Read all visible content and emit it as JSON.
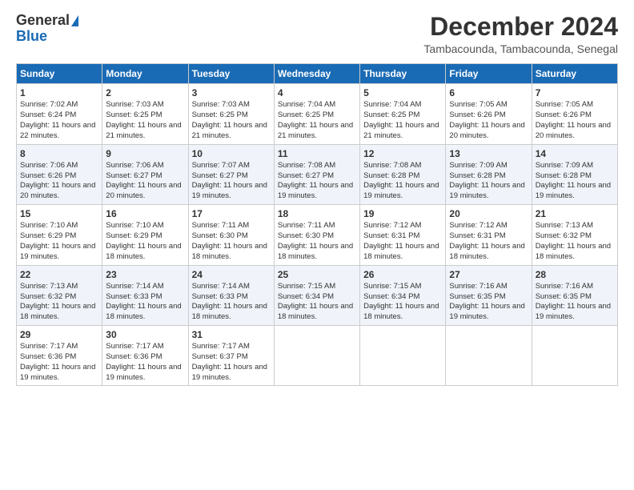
{
  "logo": {
    "general": "General",
    "blue": "Blue"
  },
  "header": {
    "title": "December 2024",
    "subtitle": "Tambacounda, Tambacounda, Senegal"
  },
  "calendar": {
    "days": [
      "Sunday",
      "Monday",
      "Tuesday",
      "Wednesday",
      "Thursday",
      "Friday",
      "Saturday"
    ],
    "weeks": [
      [
        {
          "day": "1",
          "sunrise": "Sunrise: 7:02 AM",
          "sunset": "Sunset: 6:24 PM",
          "daylight": "Daylight: 11 hours and 22 minutes."
        },
        {
          "day": "2",
          "sunrise": "Sunrise: 7:03 AM",
          "sunset": "Sunset: 6:25 PM",
          "daylight": "Daylight: 11 hours and 21 minutes."
        },
        {
          "day": "3",
          "sunrise": "Sunrise: 7:03 AM",
          "sunset": "Sunset: 6:25 PM",
          "daylight": "Daylight: 11 hours and 21 minutes."
        },
        {
          "day": "4",
          "sunrise": "Sunrise: 7:04 AM",
          "sunset": "Sunset: 6:25 PM",
          "daylight": "Daylight: 11 hours and 21 minutes."
        },
        {
          "day": "5",
          "sunrise": "Sunrise: 7:04 AM",
          "sunset": "Sunset: 6:25 PM",
          "daylight": "Daylight: 11 hours and 21 minutes."
        },
        {
          "day": "6",
          "sunrise": "Sunrise: 7:05 AM",
          "sunset": "Sunset: 6:26 PM",
          "daylight": "Daylight: 11 hours and 20 minutes."
        },
        {
          "day": "7",
          "sunrise": "Sunrise: 7:05 AM",
          "sunset": "Sunset: 6:26 PM",
          "daylight": "Daylight: 11 hours and 20 minutes."
        }
      ],
      [
        {
          "day": "8",
          "sunrise": "Sunrise: 7:06 AM",
          "sunset": "Sunset: 6:26 PM",
          "daylight": "Daylight: 11 hours and 20 minutes."
        },
        {
          "day": "9",
          "sunrise": "Sunrise: 7:06 AM",
          "sunset": "Sunset: 6:27 PM",
          "daylight": "Daylight: 11 hours and 20 minutes."
        },
        {
          "day": "10",
          "sunrise": "Sunrise: 7:07 AM",
          "sunset": "Sunset: 6:27 PM",
          "daylight": "Daylight: 11 hours and 19 minutes."
        },
        {
          "day": "11",
          "sunrise": "Sunrise: 7:08 AM",
          "sunset": "Sunset: 6:27 PM",
          "daylight": "Daylight: 11 hours and 19 minutes."
        },
        {
          "day": "12",
          "sunrise": "Sunrise: 7:08 AM",
          "sunset": "Sunset: 6:28 PM",
          "daylight": "Daylight: 11 hours and 19 minutes."
        },
        {
          "day": "13",
          "sunrise": "Sunrise: 7:09 AM",
          "sunset": "Sunset: 6:28 PM",
          "daylight": "Daylight: 11 hours and 19 minutes."
        },
        {
          "day": "14",
          "sunrise": "Sunrise: 7:09 AM",
          "sunset": "Sunset: 6:28 PM",
          "daylight": "Daylight: 11 hours and 19 minutes."
        }
      ],
      [
        {
          "day": "15",
          "sunrise": "Sunrise: 7:10 AM",
          "sunset": "Sunset: 6:29 PM",
          "daylight": "Daylight: 11 hours and 19 minutes."
        },
        {
          "day": "16",
          "sunrise": "Sunrise: 7:10 AM",
          "sunset": "Sunset: 6:29 PM",
          "daylight": "Daylight: 11 hours and 18 minutes."
        },
        {
          "day": "17",
          "sunrise": "Sunrise: 7:11 AM",
          "sunset": "Sunset: 6:30 PM",
          "daylight": "Daylight: 11 hours and 18 minutes."
        },
        {
          "day": "18",
          "sunrise": "Sunrise: 7:11 AM",
          "sunset": "Sunset: 6:30 PM",
          "daylight": "Daylight: 11 hours and 18 minutes."
        },
        {
          "day": "19",
          "sunrise": "Sunrise: 7:12 AM",
          "sunset": "Sunset: 6:31 PM",
          "daylight": "Daylight: 11 hours and 18 minutes."
        },
        {
          "day": "20",
          "sunrise": "Sunrise: 7:12 AM",
          "sunset": "Sunset: 6:31 PM",
          "daylight": "Daylight: 11 hours and 18 minutes."
        },
        {
          "day": "21",
          "sunrise": "Sunrise: 7:13 AM",
          "sunset": "Sunset: 6:32 PM",
          "daylight": "Daylight: 11 hours and 18 minutes."
        }
      ],
      [
        {
          "day": "22",
          "sunrise": "Sunrise: 7:13 AM",
          "sunset": "Sunset: 6:32 PM",
          "daylight": "Daylight: 11 hours and 18 minutes."
        },
        {
          "day": "23",
          "sunrise": "Sunrise: 7:14 AM",
          "sunset": "Sunset: 6:33 PM",
          "daylight": "Daylight: 11 hours and 18 minutes."
        },
        {
          "day": "24",
          "sunrise": "Sunrise: 7:14 AM",
          "sunset": "Sunset: 6:33 PM",
          "daylight": "Daylight: 11 hours and 18 minutes."
        },
        {
          "day": "25",
          "sunrise": "Sunrise: 7:15 AM",
          "sunset": "Sunset: 6:34 PM",
          "daylight": "Daylight: 11 hours and 18 minutes."
        },
        {
          "day": "26",
          "sunrise": "Sunrise: 7:15 AM",
          "sunset": "Sunset: 6:34 PM",
          "daylight": "Daylight: 11 hours and 18 minutes."
        },
        {
          "day": "27",
          "sunrise": "Sunrise: 7:16 AM",
          "sunset": "Sunset: 6:35 PM",
          "daylight": "Daylight: 11 hours and 19 minutes."
        },
        {
          "day": "28",
          "sunrise": "Sunrise: 7:16 AM",
          "sunset": "Sunset: 6:35 PM",
          "daylight": "Daylight: 11 hours and 19 minutes."
        }
      ],
      [
        {
          "day": "29",
          "sunrise": "Sunrise: 7:17 AM",
          "sunset": "Sunset: 6:36 PM",
          "daylight": "Daylight: 11 hours and 19 minutes."
        },
        {
          "day": "30",
          "sunrise": "Sunrise: 7:17 AM",
          "sunset": "Sunset: 6:36 PM",
          "daylight": "Daylight: 11 hours and 19 minutes."
        },
        {
          "day": "31",
          "sunrise": "Sunrise: 7:17 AM",
          "sunset": "Sunset: 6:37 PM",
          "daylight": "Daylight: 11 hours and 19 minutes."
        },
        null,
        null,
        null,
        null
      ]
    ]
  }
}
